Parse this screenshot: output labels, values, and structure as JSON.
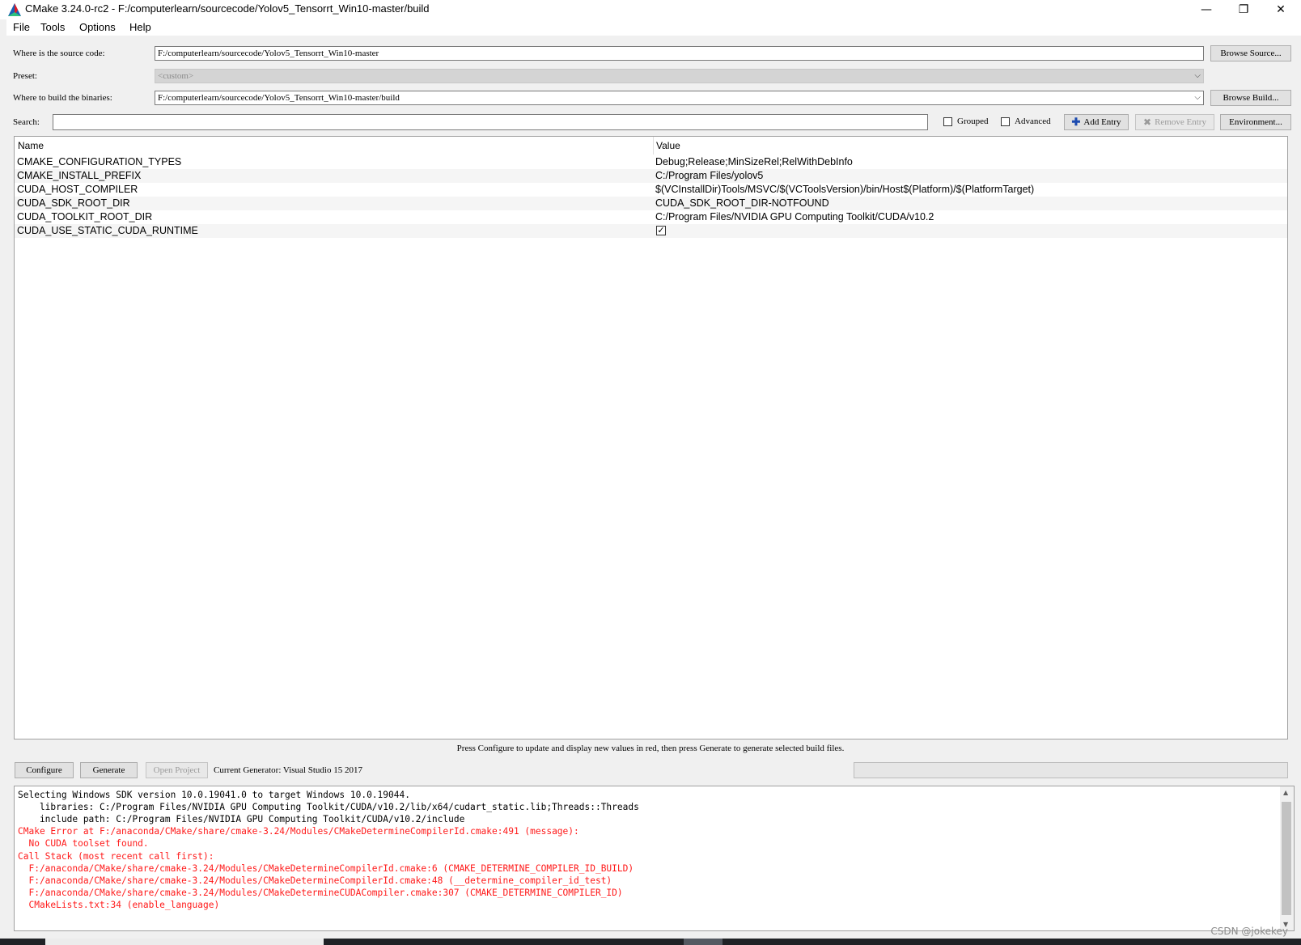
{
  "window": {
    "title": "CMake 3.24.0-rc2 - F:/computerlearn/sourcecode/Yolov5_Tensorrt_Win10-master/build",
    "minimize": "—",
    "restore": "❐",
    "close": "✕"
  },
  "menu": {
    "file": "File",
    "tools": "Tools",
    "options": "Options",
    "help": "Help"
  },
  "source": {
    "label": "Where is the source code:",
    "value": "F:/computerlearn/sourcecode/Yolov5_Tensorrt_Win10-master",
    "browse": "Browse Source..."
  },
  "preset": {
    "label": "Preset:",
    "value": "<custom>"
  },
  "build": {
    "label": "Where to build the binaries:",
    "value": "F:/computerlearn/sourcecode/Yolov5_Tensorrt_Win10-master/build",
    "browse": "Browse Build..."
  },
  "search": {
    "label": "Search:",
    "value": "",
    "grouped": "Grouped",
    "advanced": "Advanced",
    "add_entry": "Add Entry",
    "remove_entry": "Remove Entry",
    "environment": "Environment..."
  },
  "table": {
    "col_name": "Name",
    "col_value": "Value",
    "rows": [
      {
        "name": "CMAKE_CONFIGURATION_TYPES",
        "value": "Debug;Release;MinSizeRel;RelWithDebInfo"
      },
      {
        "name": "CMAKE_INSTALL_PREFIX",
        "value": "C:/Program Files/yolov5"
      },
      {
        "name": "CUDA_HOST_COMPILER",
        "value": "$(VCInstallDir)Tools/MSVC/$(VCToolsVersion)/bin/Host$(Platform)/$(PlatformTarget)"
      },
      {
        "name": "CUDA_SDK_ROOT_DIR",
        "value": "CUDA_SDK_ROOT_DIR-NOTFOUND"
      },
      {
        "name": "CUDA_TOOLKIT_ROOT_DIR",
        "value": "C:/Program Files/NVIDIA GPU Computing Toolkit/CUDA/v10.2"
      },
      {
        "name": "CUDA_USE_STATIC_CUDA_RUNTIME",
        "value": "",
        "checked": true
      }
    ]
  },
  "hint": "Press Configure to update and display new values in red, then press Generate to generate selected build files.",
  "actions": {
    "configure": "Configure",
    "generate": "Generate",
    "open_project": "Open Project",
    "generator": "Current Generator: Visual Studio 15 2017"
  },
  "log": [
    {
      "text": "Selecting Windows SDK version 10.0.19041.0 to target Windows 10.0.19044.",
      "color": "black"
    },
    {
      "text": "    libraries: C:/Program Files/NVIDIA GPU Computing Toolkit/CUDA/v10.2/lib/x64/cudart_static.lib;Threads::Threads",
      "color": "black"
    },
    {
      "text": "    include path: C:/Program Files/NVIDIA GPU Computing Toolkit/CUDA/v10.2/include",
      "color": "black"
    },
    {
      "text": "CMake Error at F:/anaconda/CMake/share/cmake-3.24/Modules/CMakeDetermineCompilerId.cmake:491 (message):",
      "color": "red"
    },
    {
      "text": "  No CUDA toolset found.",
      "color": "red"
    },
    {
      "text": "Call Stack (most recent call first):",
      "color": "red"
    },
    {
      "text": "  F:/anaconda/CMake/share/cmake-3.24/Modules/CMakeDetermineCompilerId.cmake:6 (CMAKE_DETERMINE_COMPILER_ID_BUILD)",
      "color": "red"
    },
    {
      "text": "  F:/anaconda/CMake/share/cmake-3.24/Modules/CMakeDetermineCompilerId.cmake:48 (__determine_compiler_id_test)",
      "color": "red"
    },
    {
      "text": "  F:/anaconda/CMake/share/cmake-3.24/Modules/CMakeDetermineCUDACompiler.cmake:307 (CMAKE_DETERMINE_COMPILER_ID)",
      "color": "red"
    },
    {
      "text": "  CMakeLists.txt:34 (enable_language)",
      "color": "red"
    }
  ],
  "watermark": "CSDN @jokekey",
  "colors": {
    "log_error": "#ff1a1a",
    "log_normal": "#000000",
    "window_bg": "#f0f0f0"
  }
}
